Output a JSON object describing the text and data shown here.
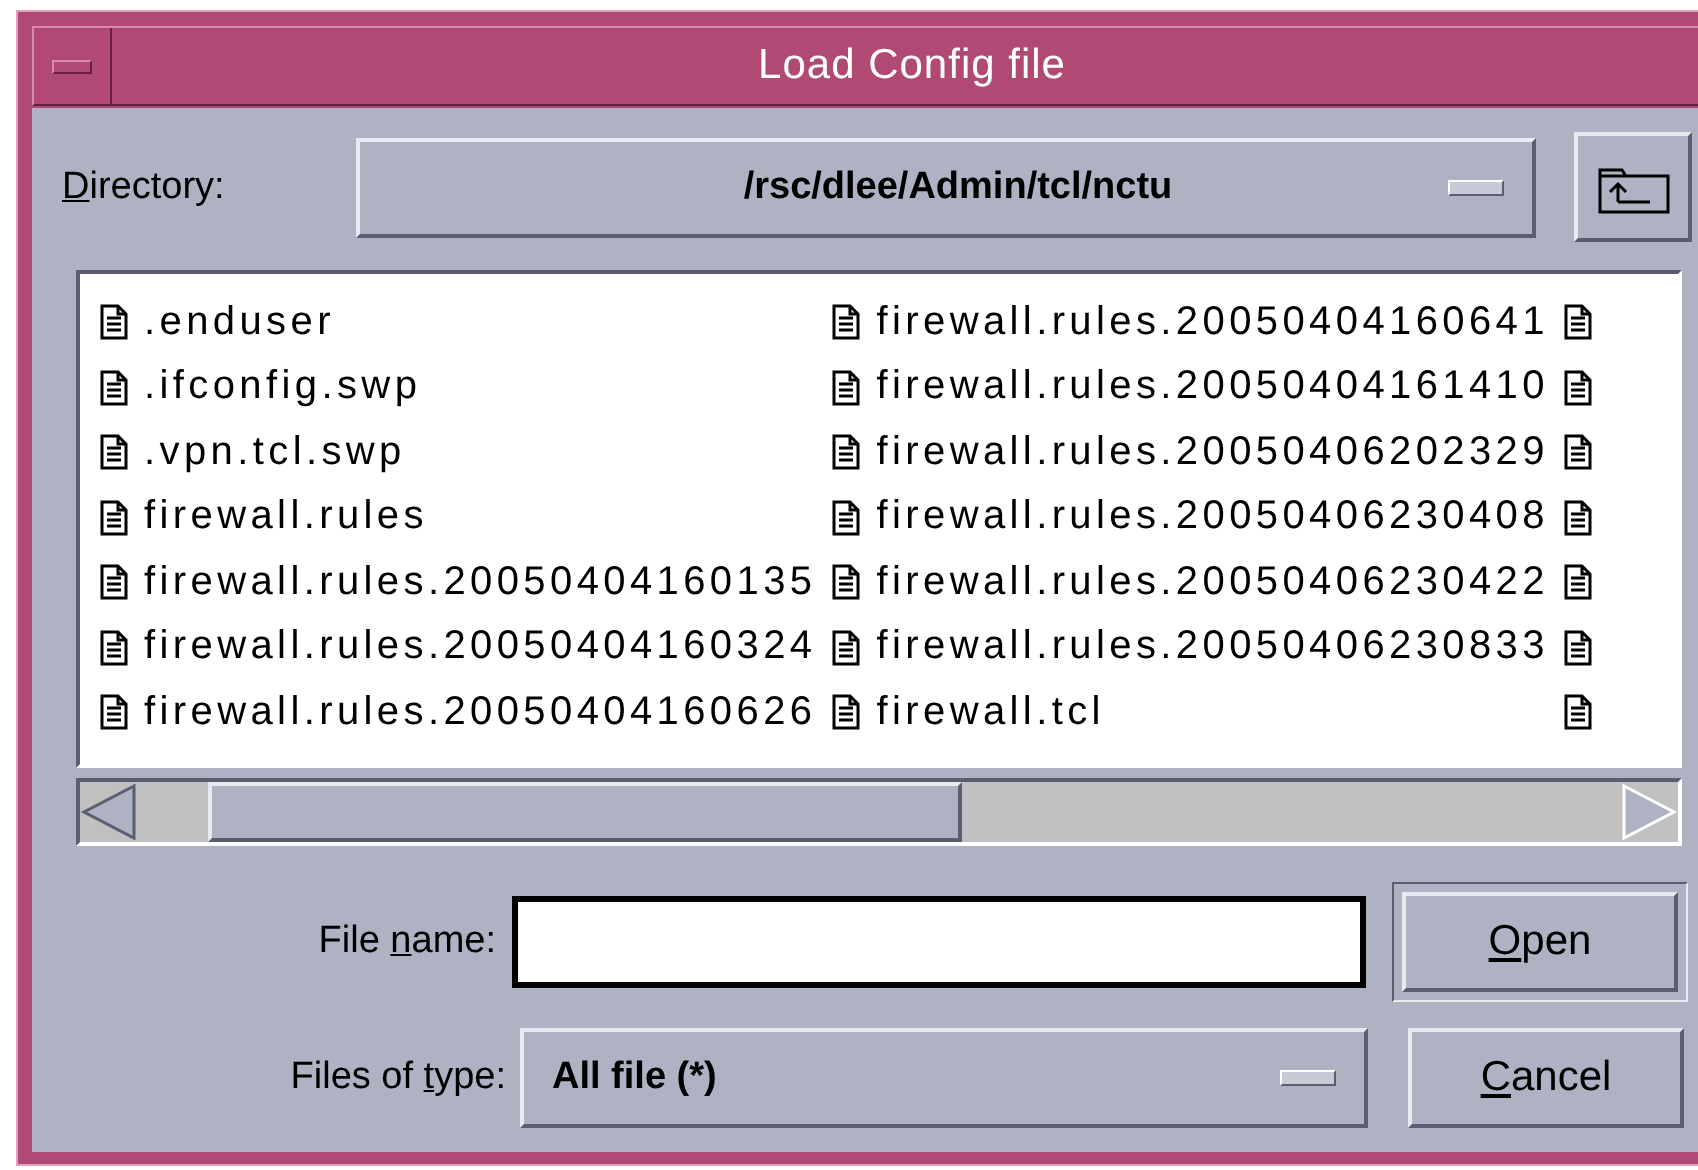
{
  "window": {
    "title": "Load Config file"
  },
  "directory": {
    "label": {
      "key": "D",
      "after": "irectory:"
    },
    "value": "/rsc/dlee/Admin/tcl/nctu"
  },
  "file_list": {
    "columns": [
      [
        {
          "kind": "file",
          "name": ".enduser"
        },
        {
          "kind": "file",
          "name": ".ifconfig.swp"
        },
        {
          "kind": "file",
          "name": ".vpn.tcl.swp"
        },
        {
          "kind": "file",
          "name": "firewall.rules"
        },
        {
          "kind": "file",
          "name": "firewall.rules.20050404160135"
        },
        {
          "kind": "file",
          "name": "firewall.rules.20050404160324"
        },
        {
          "kind": "file",
          "name": "firewall.rules.20050404160626"
        }
      ],
      [
        {
          "kind": "file",
          "name": "firewall.rules.20050404160641"
        },
        {
          "kind": "file",
          "name": "firewall.rules.20050404161410"
        },
        {
          "kind": "file",
          "name": "firewall.rules.20050406202329"
        },
        {
          "kind": "file",
          "name": "firewall.rules.20050406230408"
        },
        {
          "kind": "file",
          "name": "firewall.rules.20050406230422"
        },
        {
          "kind": "file",
          "name": "firewall.rules.20050406230833"
        },
        {
          "kind": "file",
          "name": "firewall.tcl"
        }
      ],
      [
        {
          "kind": "file"
        },
        {
          "kind": "file"
        },
        {
          "kind": "file"
        },
        {
          "kind": "file"
        },
        {
          "kind": "file"
        },
        {
          "kind": "file"
        },
        {
          "kind": "file"
        }
      ]
    ]
  },
  "file_name": {
    "label": {
      "before": "File ",
      "key": "n",
      "after": "ame:"
    }
  },
  "file_type": {
    "label": {
      "before": "Files of ",
      "key": "t",
      "after": "ype:"
    },
    "value": "All file (*)"
  },
  "buttons": [
    {
      "key": "O",
      "after": "pen",
      "default": true
    },
    {
      "key": "C",
      "after": "ancel",
      "default": false
    }
  ]
}
